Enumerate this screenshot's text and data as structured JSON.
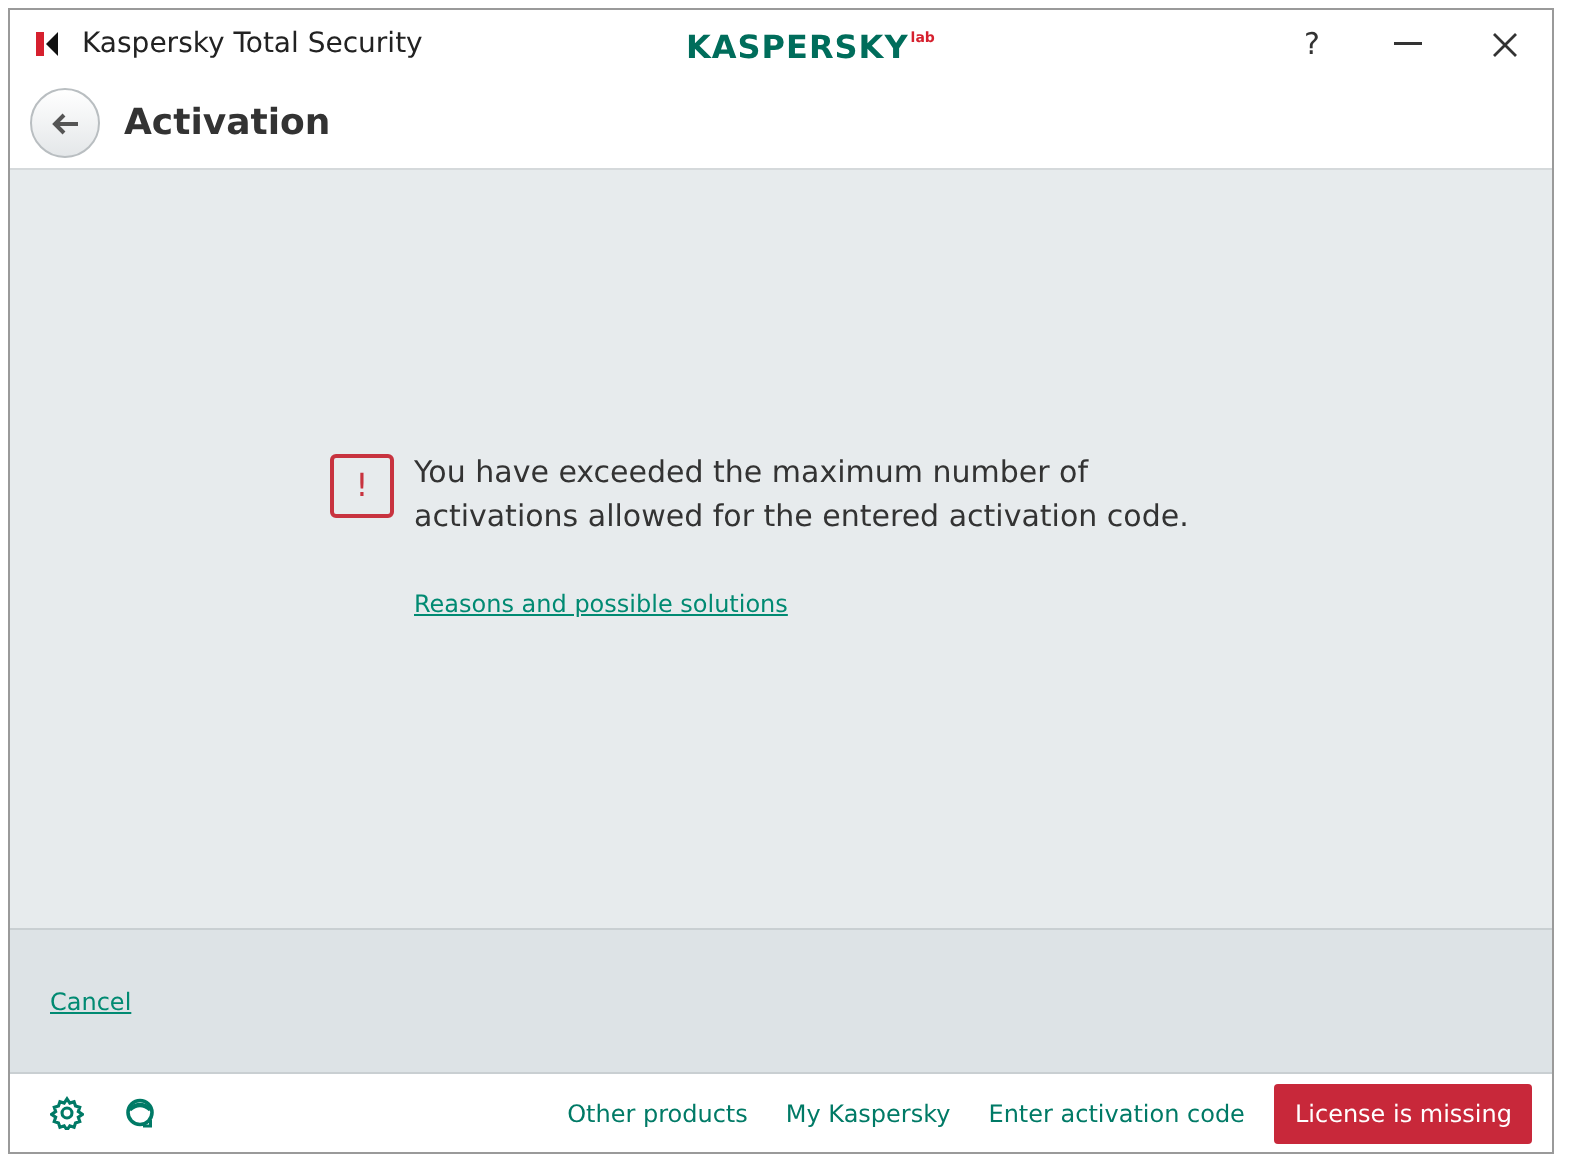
{
  "window": {
    "title": "Kaspersky Total Security",
    "logo": "KASPERSKY",
    "logo_suffix": "lab",
    "help": "?"
  },
  "header": {
    "title": "Activation"
  },
  "message": {
    "icon": "!",
    "text": "You have exceeded the maximum number of activations allowed for the entered activation code.",
    "link": "Reasons and possible solutions"
  },
  "actions": {
    "cancel": "Cancel"
  },
  "bottom_bar": {
    "links": [
      "Other products",
      "My Kaspersky",
      "Enter activation code"
    ],
    "license_button": "License is missing"
  }
}
